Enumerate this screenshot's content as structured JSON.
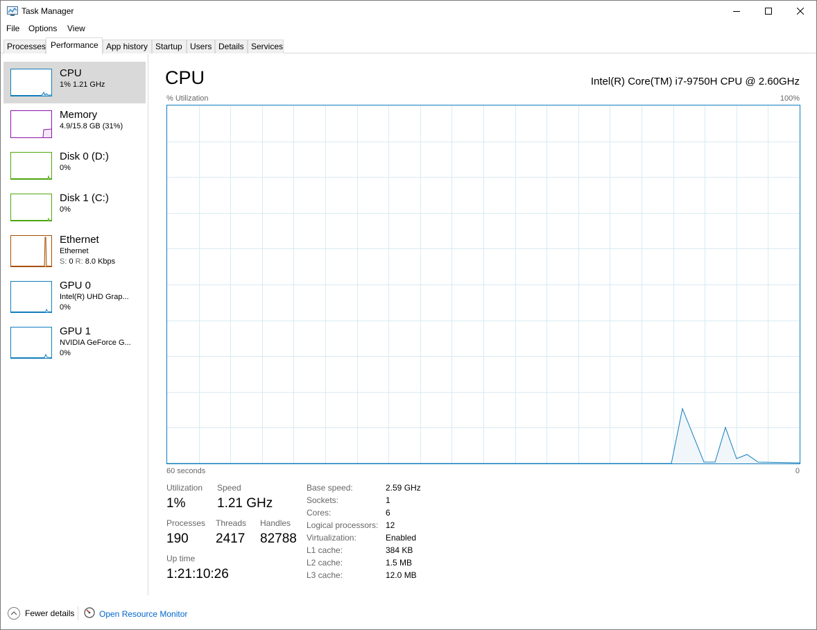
{
  "window": {
    "title": "Task Manager"
  },
  "menu": [
    "File",
    "Options",
    "View"
  ],
  "tabs": [
    "Processes",
    "Performance",
    "App history",
    "Startup",
    "Users",
    "Details",
    "Services"
  ],
  "active_tab": "Performance",
  "sidebar": {
    "items": [
      {
        "title": "CPU",
        "line1": "1% 1.21 GHz",
        "color": "#117dbb",
        "selected": true
      },
      {
        "title": "Memory",
        "line1": "4.9/15.8 GB (31%)",
        "color": "#8b12ae"
      },
      {
        "title": "Disk 0 (D:)",
        "line1": "0%",
        "color": "#4da60c"
      },
      {
        "title": "Disk 1 (C:)",
        "line1": "0%",
        "color": "#4da60c"
      },
      {
        "title": "Ethernet",
        "line1": "Ethernet",
        "line2_prefix_s": "S:",
        "line2_s": "0",
        "line2_prefix_r": "R:",
        "line2_r": "8.0 Kbps",
        "color": "#a74f01"
      },
      {
        "title": "GPU 0",
        "line1": "Intel(R) UHD Grap...",
        "line2": "0%",
        "color": "#117dbb"
      },
      {
        "title": "GPU 1",
        "line1": "NVIDIA GeForce G...",
        "line2": "0%",
        "color": "#117dbb"
      }
    ]
  },
  "main": {
    "title": "CPU",
    "cpu_model": "Intel(R) Core(TM) i7-9750H CPU @ 2.60GHz",
    "graph": {
      "y_label": "% Utilization",
      "y_max_label": "100%",
      "x_left_label": "60 seconds",
      "x_right_label": "0",
      "line_color": "#117dbb",
      "fill_color": "#f1f6fa",
      "grid_color": "#d9eaf4"
    },
    "stats": {
      "utilization_label": "Utilization",
      "utilization": "1%",
      "speed_label": "Speed",
      "speed": "1.21 GHz",
      "processes_label": "Processes",
      "processes": "190",
      "threads_label": "Threads",
      "threads": "2417",
      "handles_label": "Handles",
      "handles": "82788",
      "uptime_label": "Up time",
      "uptime": "1:21:10:26"
    },
    "details": [
      {
        "key": "Base speed:",
        "value": "2.59 GHz"
      },
      {
        "key": "Sockets:",
        "value": "1"
      },
      {
        "key": "Cores:",
        "value": "6"
      },
      {
        "key": "Logical processors:",
        "value": "12"
      },
      {
        "key": "Virtualization:",
        "value": "Enabled"
      },
      {
        "key": "L1 cache:",
        "value": "384 KB"
      },
      {
        "key": "L2 cache:",
        "value": "1.5 MB"
      },
      {
        "key": "L3 cache:",
        "value": "12.0 MB"
      }
    ]
  },
  "footer": {
    "fewer_details": "Fewer details",
    "open_resource_monitor": "Open Resource Monitor"
  }
}
